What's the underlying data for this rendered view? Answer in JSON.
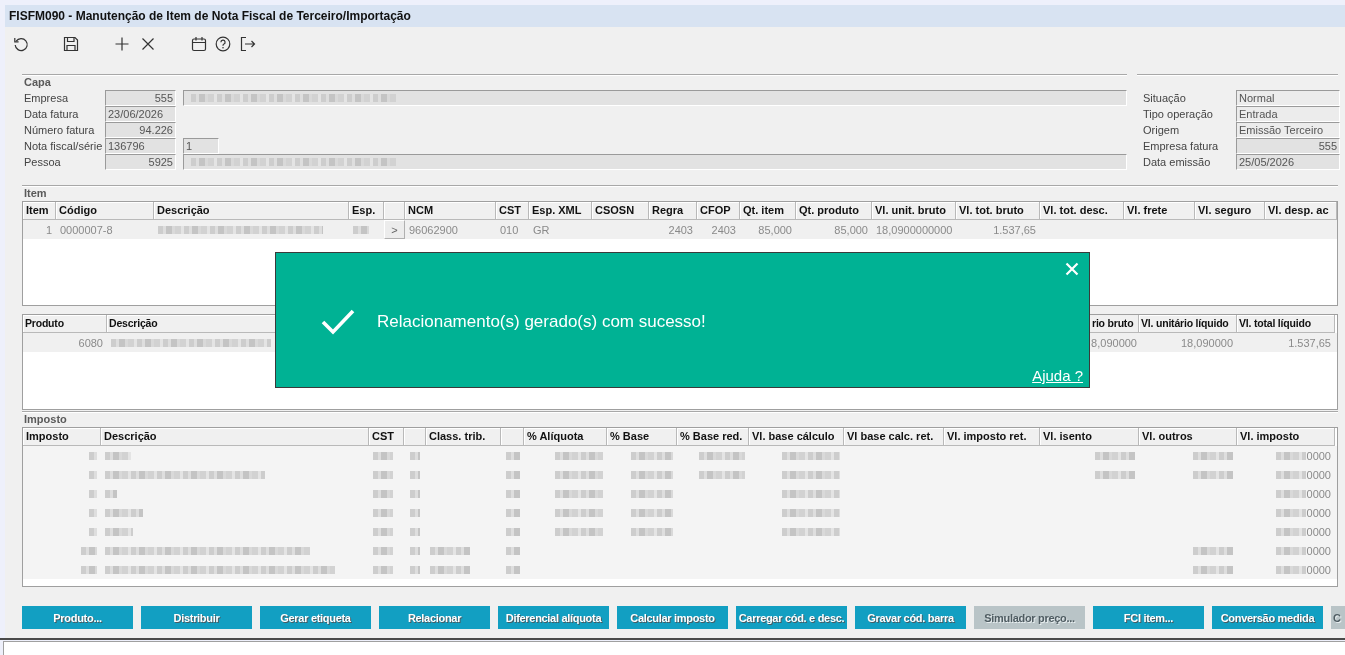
{
  "window": {
    "title": "FISFM090 - Manutenção de Item de Nota Fiscal de Terceiro/Importação"
  },
  "capa": {
    "title": "Capa",
    "rows": [
      {
        "label": "Empresa",
        "fields": [
          {
            "kind": "numeric",
            "value": "555"
          },
          {
            "kind": "blurred"
          }
        ]
      },
      {
        "label": "Data fatura",
        "fields": [
          {
            "kind": "text",
            "value": "23/06/2026"
          }
        ]
      },
      {
        "label": "Número fatura",
        "fields": [
          {
            "kind": "numeric",
            "value": "94.226"
          }
        ]
      },
      {
        "label": "Nota fiscal/série",
        "fields": [
          {
            "kind": "text",
            "value": "136796"
          },
          {
            "kind": "text",
            "value": "1"
          }
        ]
      },
      {
        "label": "Pessoa",
        "fields": [
          {
            "kind": "numeric",
            "value": "5925"
          },
          {
            "kind": "blurred"
          }
        ]
      }
    ]
  },
  "details": [
    {
      "label": "Situação",
      "field": {
        "kind": "select",
        "value": "Normal"
      }
    },
    {
      "label": "Tipo operação",
      "field": {
        "kind": "select",
        "value": "Entrada"
      }
    },
    {
      "label": "Origem",
      "field": {
        "kind": "select",
        "value": "Emissão Terceiro"
      }
    },
    {
      "label": "Empresa fatura",
      "field": {
        "kind": "numeric",
        "value": "555"
      }
    },
    {
      "label": "Data emissão",
      "field": {
        "kind": "text",
        "value": "25/05/2026"
      }
    }
  ],
  "item": {
    "title": "Item",
    "columns": [
      "Item",
      "Código",
      "Descrição",
      "Esp.",
      null,
      "NCM",
      "CST",
      "Esp. XML",
      "CSOSN",
      "Regra",
      "CFOP",
      "Qt. item",
      "Qt. produto",
      "Vl. unit. bruto",
      "Vl. tot. bruto",
      "Vl. tot. desc.",
      "Vl. frete",
      "Vl. seguro",
      "Vl. desp. ac"
    ],
    "rows": [
      {
        "cells": [
          "1",
          "0000007-8",
          {
            "kind": "blurred"
          },
          {
            "kind": "blurred"
          },
          {
            "kind": "button",
            "text": ">"
          },
          "96062900",
          "010",
          "GR",
          null,
          "2403",
          "2403",
          "85,000",
          "85,000",
          "18,0900000000",
          "1.537,65",
          null,
          null,
          null,
          null
        ]
      }
    ]
  },
  "produto": {
    "columns": [
      "Produto",
      "Descrição",
      "rio bruto",
      "Vl. unitário líquido",
      "Vl. total líquido"
    ],
    "rows": [
      {
        "cells": [
          "6080",
          {
            "kind": "blurred"
          },
          "8,090000",
          "18,090000",
          "1.537,65"
        ]
      }
    ]
  },
  "imposto": {
    "title": "Imposto",
    "columns": [
      "Imposto",
      "Descrição",
      "CST",
      null,
      "Class. trib.",
      null,
      "% Alíquota",
      "% Base",
      "% Base red.",
      "Vl. base cálculo",
      "Vl base calc. ret.",
      "Vl. imposto ret.",
      "Vl. isento",
      "Vl. outros",
      "Vl. imposto"
    ],
    "rows": [
      {
        "cells": [
          {
            "kind": "blurred"
          },
          {
            "kind": "blurred"
          },
          {
            "kind": "blurred"
          },
          {
            "kind": "blurred"
          },
          null,
          {
            "kind": "blurred"
          },
          {
            "kind": "blurred"
          },
          {
            "kind": "blurred"
          },
          {
            "kind": "blurred"
          },
          {
            "kind": "blurred"
          },
          null,
          null,
          {
            "kind": "blurred"
          },
          {
            "kind": "blurred"
          },
          {
            "kind": "masked",
            "text": "0000"
          }
        ]
      },
      {
        "cells": [
          {
            "kind": "blurred"
          },
          {
            "kind": "blurred"
          },
          {
            "kind": "blurred"
          },
          {
            "kind": "blurred"
          },
          null,
          {
            "kind": "blurred"
          },
          {
            "kind": "blurred"
          },
          {
            "kind": "blurred"
          },
          {
            "kind": "blurred"
          },
          {
            "kind": "blurred"
          },
          null,
          null,
          {
            "kind": "blurred"
          },
          {
            "kind": "blurred"
          },
          {
            "kind": "masked",
            "text": "0000"
          }
        ]
      },
      {
        "cells": [
          {
            "kind": "blurred"
          },
          {
            "kind": "blurred"
          },
          {
            "kind": "blurred"
          },
          {
            "kind": "blurred"
          },
          null,
          {
            "kind": "blurred"
          },
          {
            "kind": "blurred"
          },
          {
            "kind": "blurred"
          },
          null,
          {
            "kind": "blurred"
          },
          null,
          null,
          null,
          null,
          {
            "kind": "masked",
            "text": "0000"
          }
        ]
      },
      {
        "cells": [
          {
            "kind": "blurred"
          },
          {
            "kind": "blurred"
          },
          {
            "kind": "blurred"
          },
          {
            "kind": "blurred"
          },
          null,
          {
            "kind": "blurred"
          },
          {
            "kind": "blurred"
          },
          {
            "kind": "blurred"
          },
          null,
          {
            "kind": "blurred"
          },
          null,
          null,
          null,
          null,
          {
            "kind": "masked",
            "text": "0000"
          }
        ]
      },
      {
        "cells": [
          {
            "kind": "blurred"
          },
          {
            "kind": "blurred"
          },
          {
            "kind": "blurred"
          },
          {
            "kind": "blurred"
          },
          null,
          {
            "kind": "blurred"
          },
          {
            "kind": "blurred"
          },
          {
            "kind": "blurred"
          },
          null,
          {
            "kind": "blurred"
          },
          null,
          null,
          null,
          null,
          {
            "kind": "masked",
            "text": "0000"
          }
        ]
      },
      {
        "cells": [
          {
            "kind": "blurred"
          },
          {
            "kind": "blurred"
          },
          {
            "kind": "blurred"
          },
          {
            "kind": "blurred"
          },
          {
            "kind": "blurred"
          },
          {
            "kind": "blurred"
          },
          null,
          null,
          null,
          null,
          null,
          null,
          null,
          {
            "kind": "blurred"
          },
          {
            "kind": "masked",
            "text": "0000"
          }
        ]
      },
      {
        "cells": [
          {
            "kind": "blurred"
          },
          {
            "kind": "blurred"
          },
          {
            "kind": "blurred"
          },
          {
            "kind": "blurred"
          },
          {
            "kind": "blurred"
          },
          {
            "kind": "blurred"
          },
          null,
          null,
          null,
          null,
          null,
          null,
          null,
          {
            "kind": "blurred"
          },
          {
            "kind": "masked",
            "text": "0000"
          }
        ]
      }
    ]
  },
  "toast": {
    "message": "Relacionamento(s) gerado(s) com sucesso!",
    "help_link": "Ajuda ?"
  },
  "buttons": [
    {
      "label": "Produto...",
      "disabled": false
    },
    {
      "label": "Distribuir",
      "disabled": false
    },
    {
      "label": "Gerar etiqueta",
      "disabled": false
    },
    {
      "label": "Relacionar",
      "disabled": false
    },
    {
      "label": "Diferencial alíquota",
      "disabled": false
    },
    {
      "label": "Calcular imposto",
      "disabled": false
    },
    {
      "label": "Carregar cód. e desc.",
      "disabled": false
    },
    {
      "label": "Gravar cód. barra",
      "disabled": false
    },
    {
      "label": "Simulador preço...",
      "disabled": true
    },
    {
      "label": "FCI item...",
      "disabled": false
    },
    {
      "label": "Conversão medida",
      "disabled": false
    },
    {
      "label": "C",
      "disabled": true
    }
  ]
}
